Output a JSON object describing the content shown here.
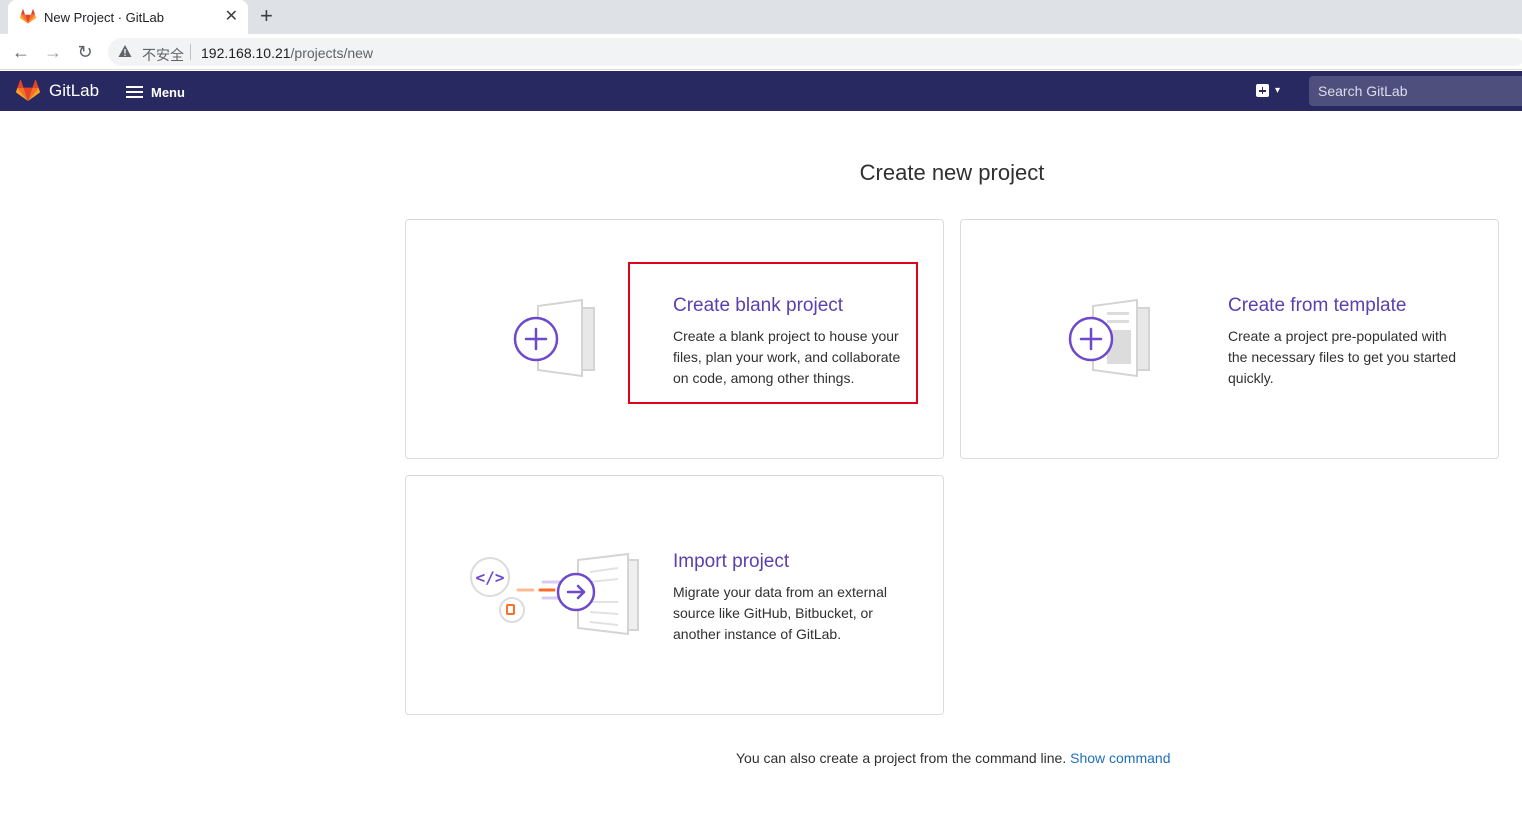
{
  "browser": {
    "tab_title": "New Project · GitLab",
    "insecure_label": "不安全",
    "url_host": "192.168.10.21",
    "url_path": "/projects/new"
  },
  "header": {
    "brand": "GitLab",
    "menu_label": "Menu",
    "search_placeholder": "Search GitLab"
  },
  "main": {
    "title": "Create new project",
    "cards": [
      {
        "title": "Create blank project",
        "description": "Create a blank project to house your files, plan your work, and collaborate on code, among other things."
      },
      {
        "title": "Create from template",
        "description": "Create a project pre-populated with the necessary files to get you started quickly."
      },
      {
        "title": "Import project",
        "description": "Migrate your data from an external source like GitHub, Bitbucket, or another instance of GitLab."
      }
    ],
    "footer_text": "You can also create a project from the command line.",
    "footer_link": "Show command"
  },
  "colors": {
    "header_bg": "#292961",
    "accent_purple": "#5b3fae",
    "highlight_red": "#e0001b",
    "link_blue": "#1f6fbf"
  }
}
